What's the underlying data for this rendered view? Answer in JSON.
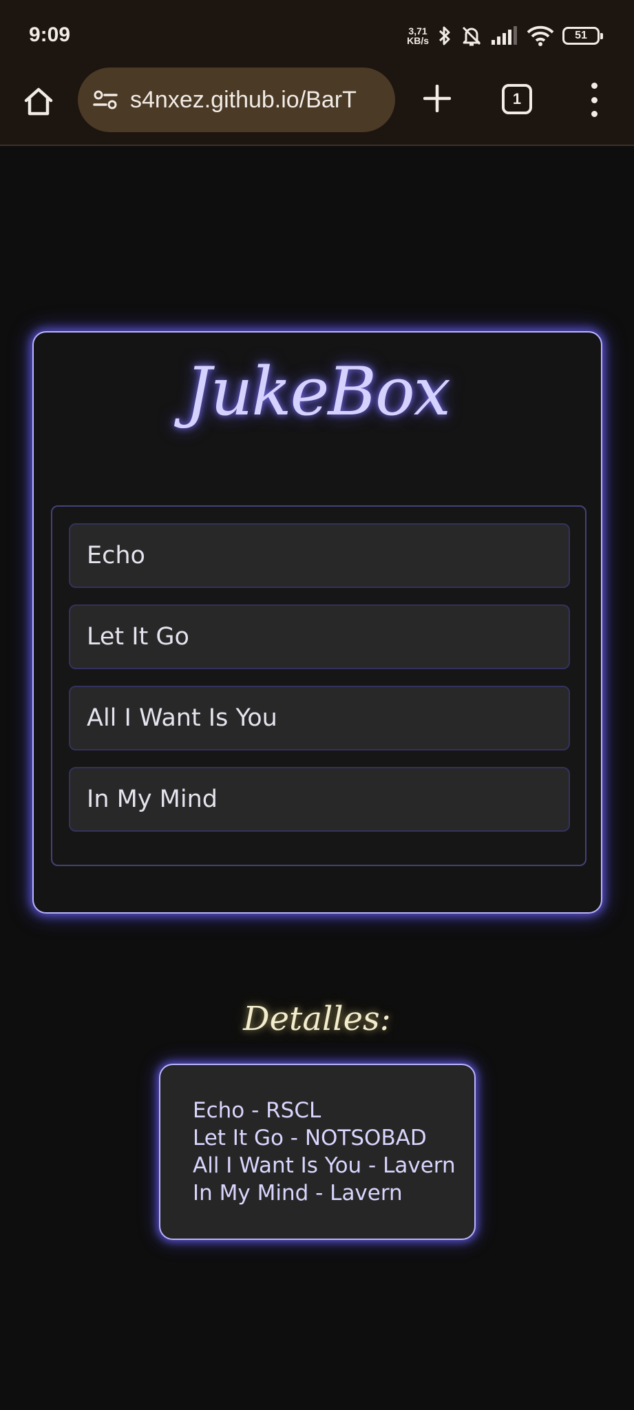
{
  "status_bar": {
    "time": "9:09",
    "net_speed_value": "3,71",
    "net_speed_unit": "KB/s",
    "battery": "51",
    "icons": [
      "bluetooth-icon",
      "bell-muted-icon",
      "signal-icon",
      "wifi-icon",
      "battery-icon"
    ]
  },
  "browser": {
    "url": "s4nxez.github.io/BarT",
    "tab_count": "1",
    "icons": [
      "home-icon",
      "site-settings-icon",
      "new-tab-icon",
      "tabs-icon",
      "more-icon"
    ]
  },
  "jukebox": {
    "title": "JukeBox",
    "songs": [
      {
        "label": "Echo"
      },
      {
        "label": "Let It Go"
      },
      {
        "label": "All I Want Is You"
      },
      {
        "label": "In My Mind"
      }
    ]
  },
  "details": {
    "heading": "Detalles:",
    "lines": [
      "Echo - RSCL",
      "Let It Go - NOTSOBAD",
      "All I Want Is You - Lavern",
      "In My Mind - Lavern"
    ]
  },
  "colors": {
    "page_bg": "#0e0e0e",
    "chrome_bg": "#1d150f",
    "omnibox_bg": "#4a3a26",
    "neon_purple": "#b9b5ff",
    "song_bg": "#282828",
    "details_heading": "#f3edcf"
  }
}
